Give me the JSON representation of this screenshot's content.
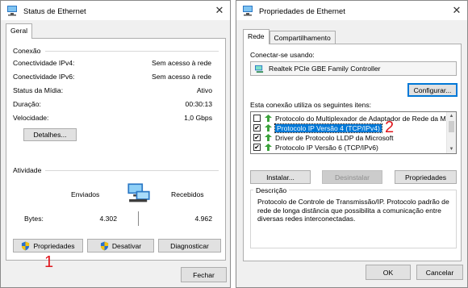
{
  "left_window": {
    "title": "Status de Ethernet",
    "tab": "Geral",
    "connection_header": "Conexão",
    "rows": [
      {
        "label": "Conectividade IPv4:",
        "value": "Sem acesso à rede"
      },
      {
        "label": "Conectividade IPv6:",
        "value": "Sem acesso à rede"
      },
      {
        "label": "Status da Mídia:",
        "value": "Ativo"
      },
      {
        "label": "Duração:",
        "value": "00:30:13"
      },
      {
        "label": "Velocidade:",
        "value": "1,0 Gbps"
      }
    ],
    "details_button": "Detalhes...",
    "activity_header": "Atividade",
    "sent_label": "Enviados",
    "received_label": "Recebidos",
    "bytes_label": "Bytes:",
    "bytes_sent": "4.302",
    "bytes_received": "4.962",
    "properties_button": "Propriedades",
    "disable_button": "Desativar",
    "diagnose_button": "Diagnosticar",
    "close_button": "Fechar",
    "annotation": "1"
  },
  "right_window": {
    "title": "Propriedades de Ethernet",
    "tabs": [
      "Rede",
      "Compartilhamento"
    ],
    "connect_using_label": "Conectar-se usando:",
    "adapter_name": "Realtek PCIe GBE Family Controller",
    "configure_button": "Configurar...",
    "items_label": "Esta conexão utiliza os seguintes itens:",
    "items": [
      {
        "label": "Protocolo do Multiplexador de Adaptador de Rede da M",
        "checked": false
      },
      {
        "label": "Protocolo IP Versão 4 (TCP/IPv4)",
        "checked": true
      },
      {
        "label": "Driver de Protocolo LLDP da Microsoft",
        "checked": true
      },
      {
        "label": "Protocolo IP Versão 6 (TCP/IPv6)",
        "checked": true
      }
    ],
    "install_button": "Instalar...",
    "uninstall_button": "Desinstalar",
    "properties_button": "Propriedades",
    "description_header": "Descrição",
    "description_text": "Protocolo de Controle de Transmissão/IP. Protocolo padrão de rede de longa distância que possibilita a comunicação entre diversas redes interconectadas.",
    "ok_button": "OK",
    "cancel_button": "Cancelar",
    "annotation": "2"
  },
  "colors": {
    "accent": "#0078d7",
    "annotation": "#e0161d",
    "window_bg": "#f0f0f0"
  }
}
